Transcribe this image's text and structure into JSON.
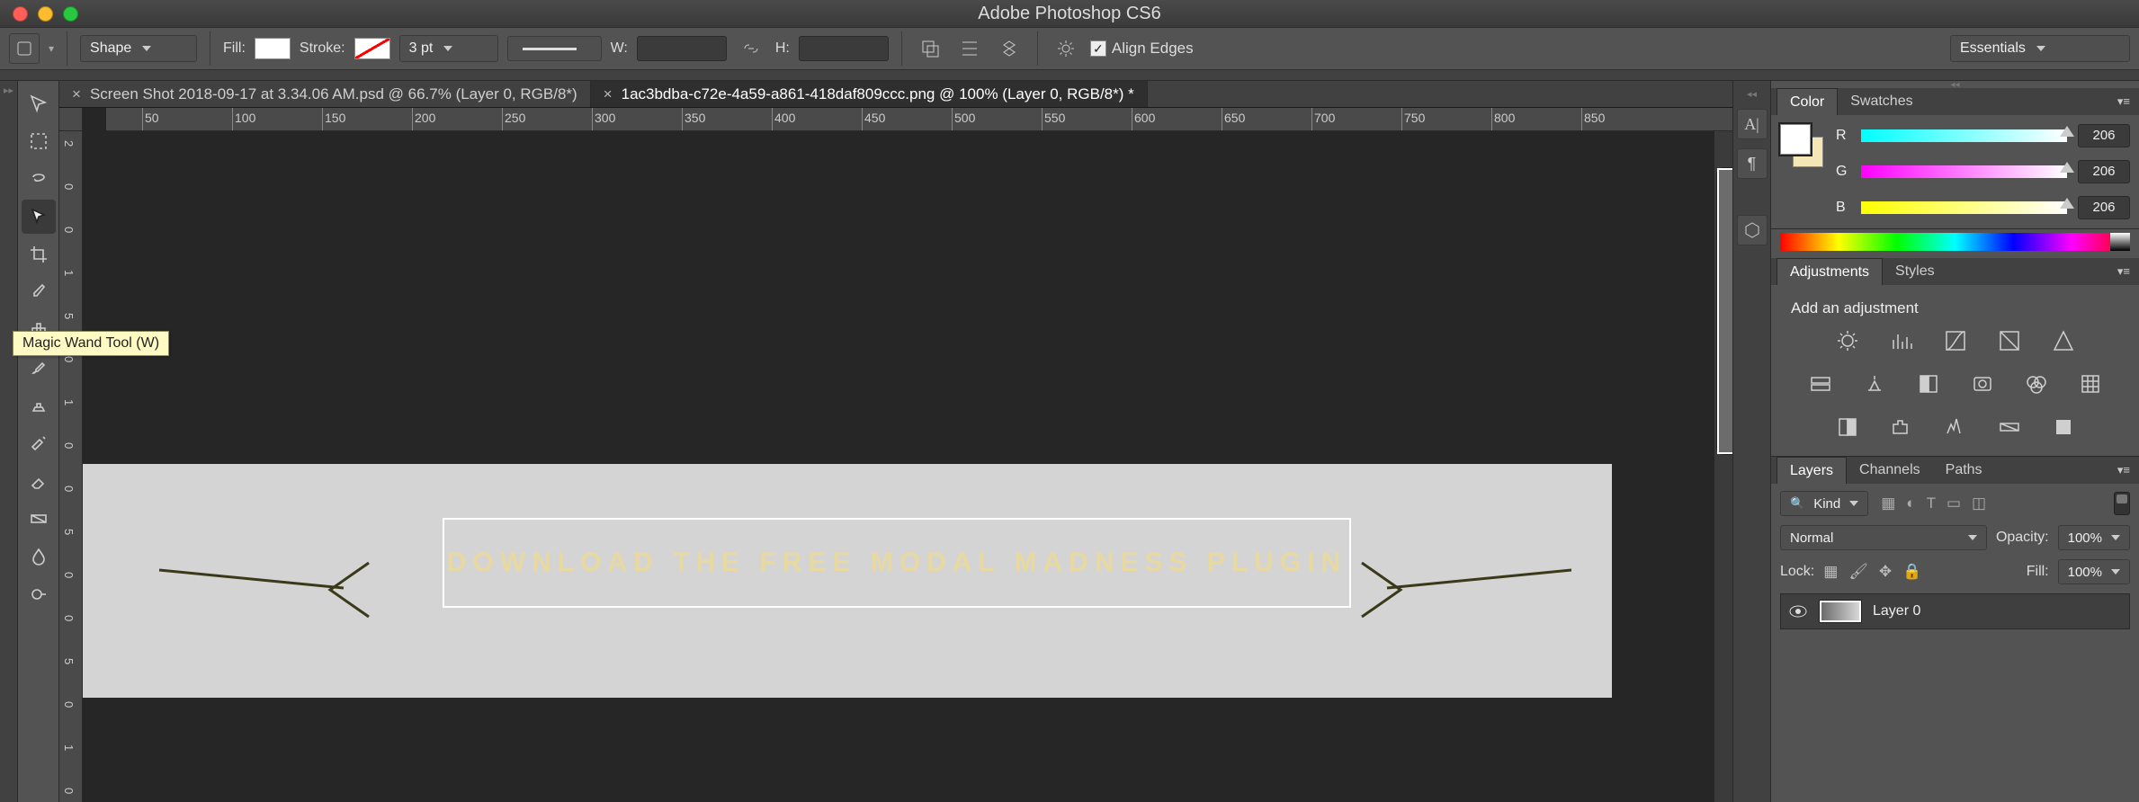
{
  "app_title": "Adobe Photoshop CS6",
  "options": {
    "shape_mode": "Shape",
    "fill_label": "Fill:",
    "stroke_label": "Stroke:",
    "stroke_size": "3 pt",
    "w_label": "W:",
    "h_label": "H:",
    "align_edges": "Align Edges",
    "workspace": "Essentials"
  },
  "tabs": [
    {
      "close": "×",
      "title": "Screen Shot 2018-09-17 at 3.34.06 AM.psd @ 66.7% (Layer 0, RGB/8*)"
    },
    {
      "close": "×",
      "title": "1ac3bdba-c72e-4a59-a861-418daf809ccc.png @ 100% (Layer 0, RGB/8*) *"
    }
  ],
  "tooltip": "Magic Wand Tool (W)",
  "ruler_h": [
    "50",
    "100",
    "150",
    "200",
    "250",
    "300",
    "350",
    "400",
    "450",
    "500",
    "550",
    "600",
    "650",
    "700",
    "750",
    "800",
    "850"
  ],
  "ruler_v": [
    "2",
    "0",
    "0",
    "1",
    "5",
    "0",
    "1",
    "0",
    "0",
    "5",
    "0",
    "0",
    "5",
    "0",
    "1",
    "0"
  ],
  "canvas": {
    "button_text": "DOWNLOAD THE FREE MODAL MADNESS PLUGIN"
  },
  "panels": {
    "color": {
      "tab_color": "Color",
      "tab_swatches": "Swatches",
      "r": "R",
      "g": "G",
      "b": "B",
      "r_val": "206",
      "g_val": "206",
      "b_val": "206"
    },
    "adjustments": {
      "tab_adj": "Adjustments",
      "tab_styles": "Styles",
      "title": "Add an adjustment"
    },
    "layers": {
      "tab_layers": "Layers",
      "tab_channels": "Channels",
      "tab_paths": "Paths",
      "filter_kind": "Kind",
      "blend_mode": "Normal",
      "opacity_label": "Opacity:",
      "opacity_val": "100%",
      "lock_label": "Lock:",
      "fill_label": "Fill:",
      "fill_val": "100%",
      "layer0": "Layer 0"
    }
  }
}
